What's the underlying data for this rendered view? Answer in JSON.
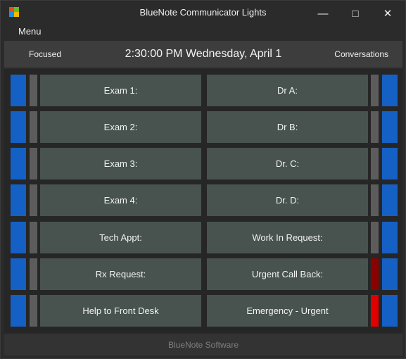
{
  "window": {
    "title": "BlueNote Communicator Lights",
    "minimize_glyph": "—",
    "maximize_glyph": "□",
    "close_glyph": "✕"
  },
  "menu": {
    "label": "Menu"
  },
  "header": {
    "left_label": "Focused",
    "datetime": "2:30:00 PM  Wednesday, April 1",
    "right_label": "Conversations"
  },
  "rows": [
    {
      "left": "Exam 1:",
      "right": "Dr A:"
    },
    {
      "left": "Exam 2:",
      "right": "Dr B:"
    },
    {
      "left": "Exam 3:",
      "right": "Dr. C:"
    },
    {
      "left": "Exam 4:",
      "right": "Dr. D:"
    },
    {
      "left": "Tech Appt:",
      "right": "Work In Request:"
    },
    {
      "left": "Rx Request:",
      "right": "Urgent Call Back:"
    },
    {
      "left": "Help to Front Desk",
      "right": "Emergency - Urgent"
    }
  ],
  "indicator_colors": {
    "left": [
      "#5c5c5c",
      "#5c5c5c",
      "#5c5c5c",
      "#5c5c5c",
      "#5c5c5c",
      "#5c5c5c",
      "#5c5c5c"
    ],
    "right": [
      "#5c5c5c",
      "#5c5c5c",
      "#5c5c5c",
      "#5c5c5c",
      "#5c5c5c",
      "#8b0000",
      "#e00000"
    ]
  },
  "accent_color": "#1560c4",
  "footer": {
    "text": "BlueNote Software"
  }
}
